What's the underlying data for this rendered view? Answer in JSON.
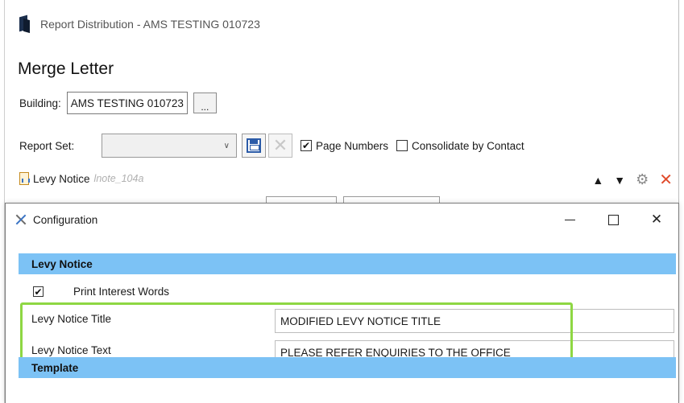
{
  "window": {
    "title": "Report Distribution - AMS TESTING 010723"
  },
  "page": {
    "heading": "Merge Letter"
  },
  "building": {
    "label": "Building:",
    "value": "AMS TESTING 010723",
    "browse_label": "..."
  },
  "report_set": {
    "label": "Report Set:",
    "selected": "",
    "page_numbers_label": "Page Numbers",
    "page_numbers_checked": "✔",
    "consolidate_label": "Consolidate by Contact"
  },
  "report_item": {
    "name": "Levy Notice",
    "code": "lnote_104a"
  },
  "dialog": {
    "title": "Configuration",
    "sections": {
      "levy": {
        "header": "Levy Notice",
        "print_interest_label": "Print Interest Words",
        "print_interest_checked": "✔",
        "fields": [
          {
            "label": "Levy Notice Title",
            "value": "MODIFIED LEVY NOTICE TITLE"
          },
          {
            "label": "Levy Notice Text",
            "value": "PLEASE REFER ENQUIRIES TO THE OFFICE"
          }
        ]
      },
      "template": {
        "header": "Template"
      }
    }
  },
  "colors": {
    "section_bar": "#7cc2f5",
    "highlight": "#8ed743",
    "delete_red": "#e04b2b"
  }
}
